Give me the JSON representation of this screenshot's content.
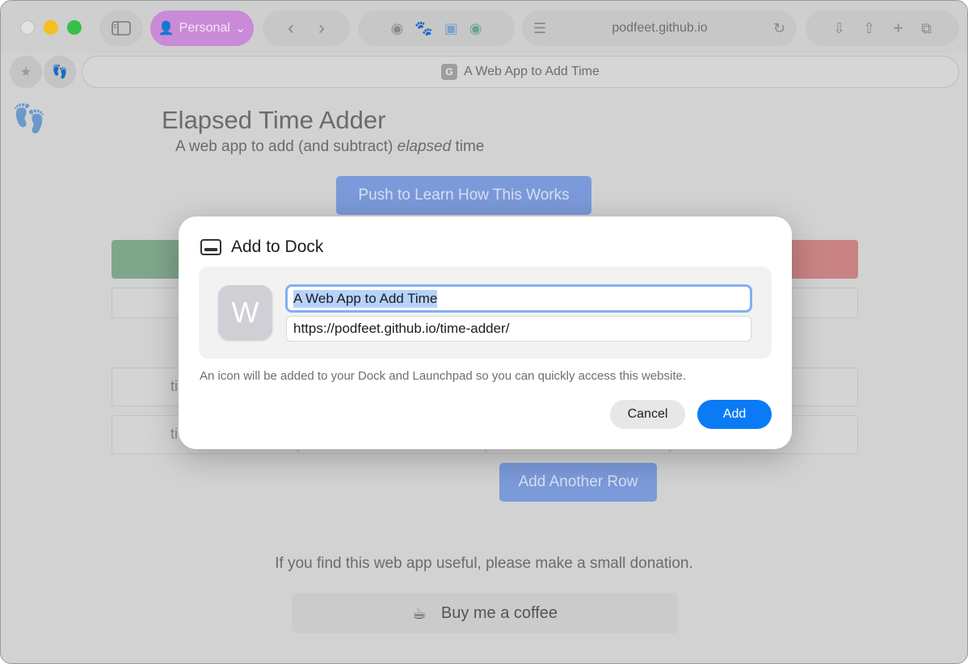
{
  "toolbar": {
    "profile_label": "Personal",
    "address": "podfeet.github.io"
  },
  "tab": {
    "favicon_letter": "G",
    "title": "A Web App to Add Time"
  },
  "page": {
    "title": "Elapsed Time Adder",
    "subtitle_pre": "A web app to add (and subtract) ",
    "subtitle_em": "elapsed",
    "subtitle_post": " time",
    "learn_button": "Push to Learn How This Works",
    "row1_fragment": "ti",
    "row2_fragment": "ti",
    "add_row_button": "Add Another Row",
    "donate_text": "If you find this web app useful, please make a small donation.",
    "coffee_button": "Buy me a coffee"
  },
  "dialog": {
    "title": "Add to Dock",
    "app_icon_letter": "W",
    "name_value": "A Web App to Add Time",
    "url_value": "https://podfeet.github.io/time-adder/",
    "description": "An icon will be added to your Dock and Launchpad so you can quickly access this website.",
    "cancel_label": "Cancel",
    "add_label": "Add"
  },
  "colors": {
    "accent": "#0a7bf5",
    "profile": "#c98ad7",
    "page_button": "#7b9ad9"
  }
}
